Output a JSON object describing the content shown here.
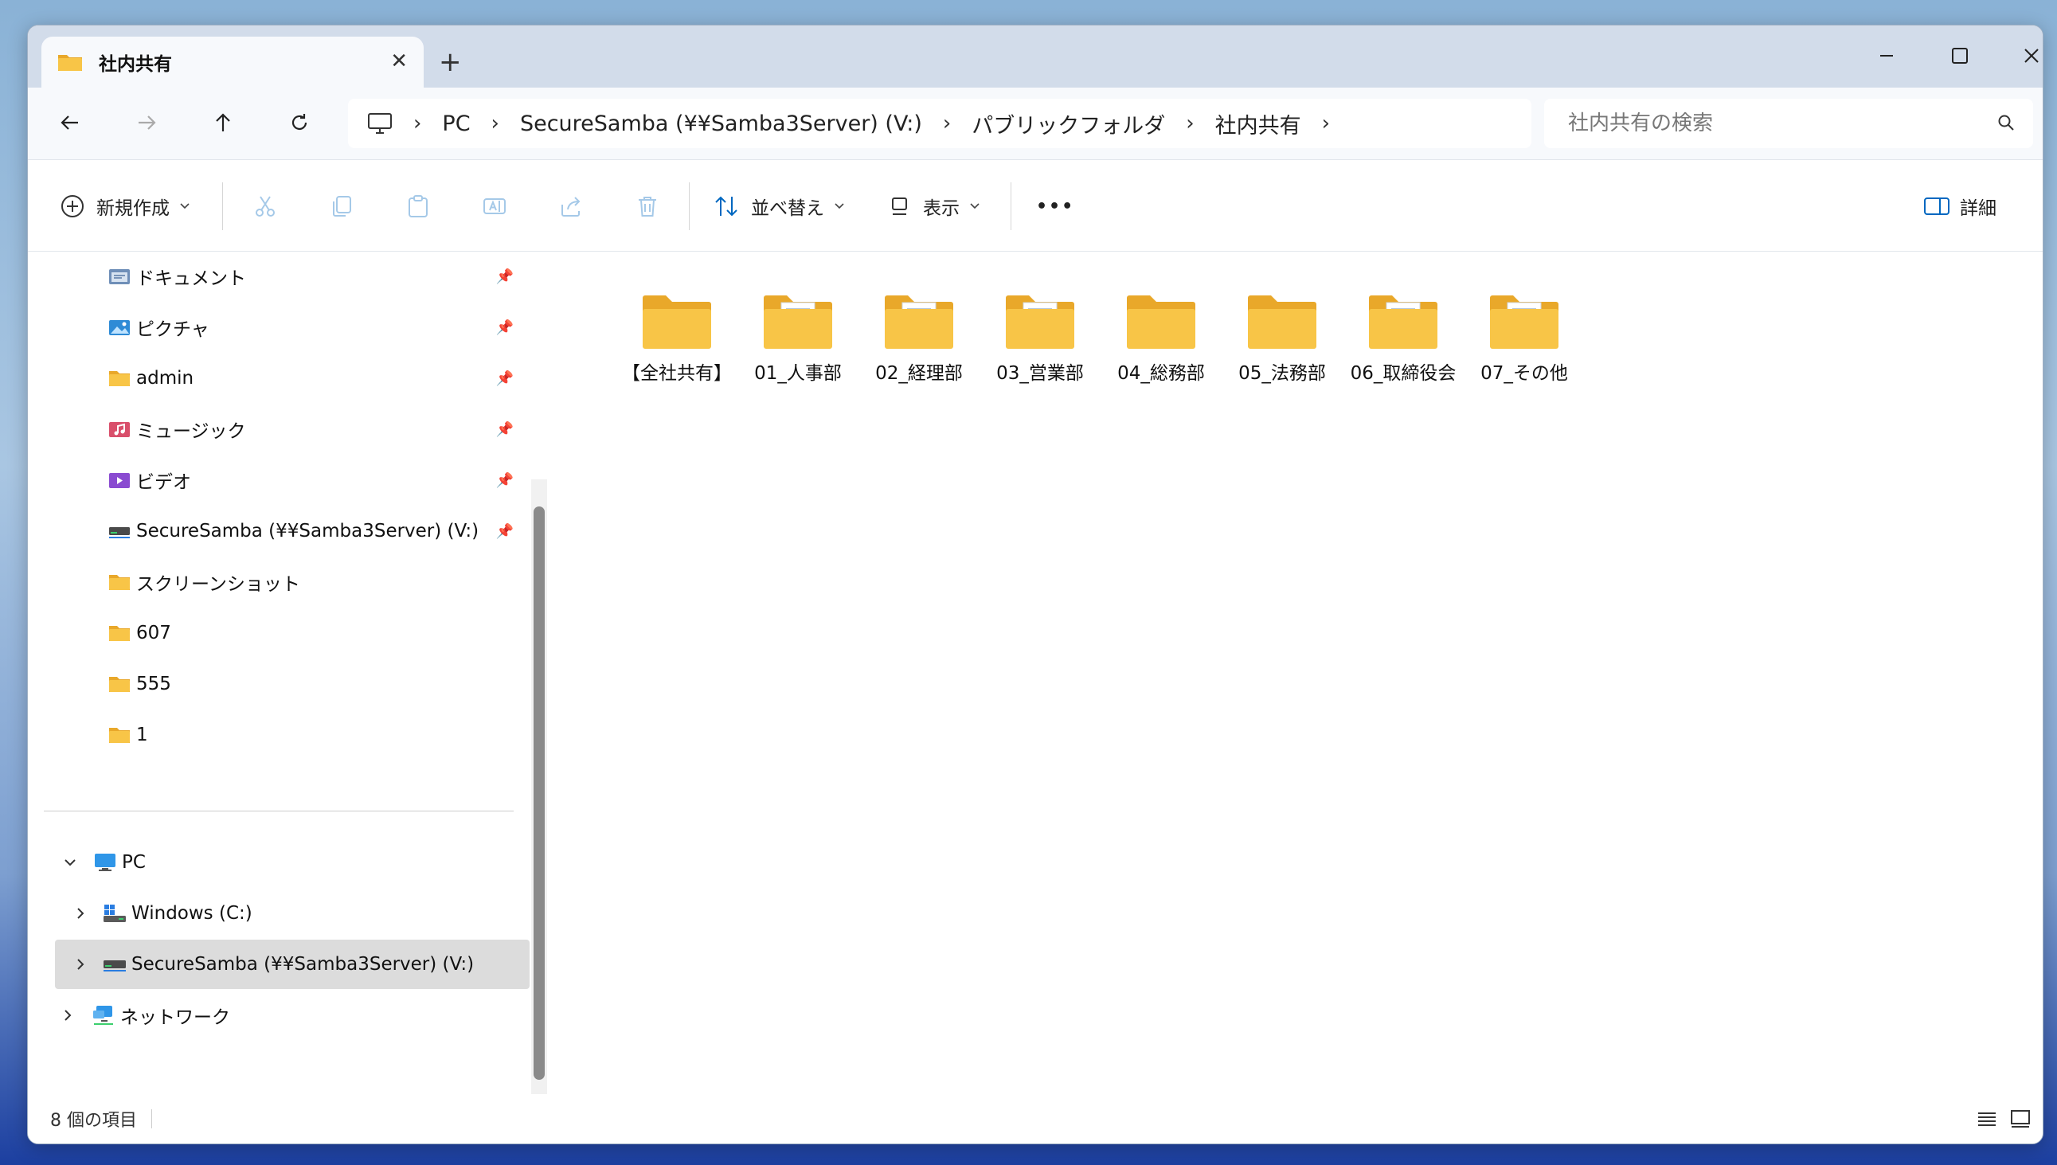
{
  "tab": {
    "title": "社内共有",
    "close": "✕",
    "new_tab": "+"
  },
  "window_controls": {
    "minimize": "—",
    "maximize": "☐",
    "close": "✕"
  },
  "breadcrumb": [
    "PC",
    "SecureSamba (¥¥Samba3Server) (V:)",
    "パブリックフォルダ",
    "社内共有"
  ],
  "search": {
    "placeholder": "社内共有の検索"
  },
  "toolbar": {
    "new": "新規作成",
    "sort": "並べ替え",
    "view": "表示",
    "more": "•••",
    "details": "詳細"
  },
  "sidebar": {
    "quick_access": [
      {
        "label": "ドキュメント",
        "icon": "documents-icon",
        "pinned": true
      },
      {
        "label": "ピクチャ",
        "icon": "pictures-icon",
        "pinned": true
      },
      {
        "label": "admin",
        "icon": "folder-icon",
        "pinned": true
      },
      {
        "label": "ミュージック",
        "icon": "music-icon",
        "pinned": true
      },
      {
        "label": "ビデオ",
        "icon": "videos-icon",
        "pinned": true
      },
      {
        "label": "SecureSamba (¥¥Samba3Server) (V:)",
        "icon": "network-drive-icon",
        "pinned": true
      },
      {
        "label": "スクリーンショット",
        "icon": "folder-icon",
        "pinned": false
      },
      {
        "label": "607",
        "icon": "folder-icon",
        "pinned": false
      },
      {
        "label": "555",
        "icon": "folder-icon",
        "pinned": false
      },
      {
        "label": "1",
        "icon": "folder-icon",
        "pinned": false
      }
    ],
    "tree": [
      {
        "label": "PC",
        "icon": "pc-icon",
        "expanded": true
      },
      {
        "label": "Windows (C:)",
        "icon": "windows-drive-icon"
      },
      {
        "label": "SecureSamba (¥¥Samba3Server) (V:)",
        "icon": "network-drive-icon",
        "selected": true
      },
      {
        "label": "ネットワーク",
        "icon": "network-icon"
      }
    ]
  },
  "files": [
    {
      "name": "【全社共有】",
      "has_excel": false
    },
    {
      "name": "01_人事部",
      "has_excel": true
    },
    {
      "name": "02_経理部",
      "has_excel": true
    },
    {
      "name": "03_営業部",
      "has_excel": true
    },
    {
      "name": "04_総務部",
      "has_excel": false
    },
    {
      "name": "05_法務部",
      "has_excel": false
    },
    {
      "name": "06_取締役会",
      "has_excel": true
    },
    {
      "name": "07_その他",
      "has_excel": true
    }
  ],
  "status": {
    "count": "8 個の項目"
  },
  "colors": {
    "accent": "#0067c0",
    "folder": "#f8c547",
    "folder_back": "#e9a82a",
    "excel": "#1d7044"
  }
}
